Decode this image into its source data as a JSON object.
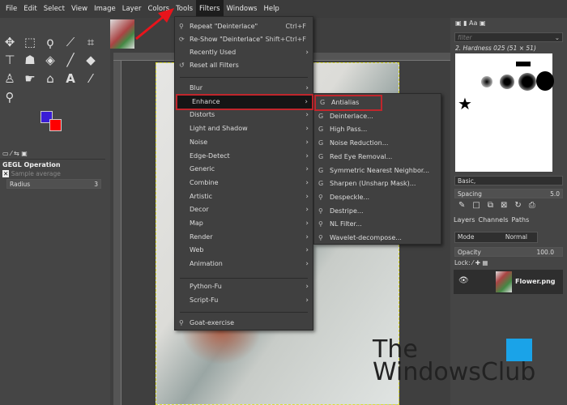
{
  "menubar": [
    "File",
    "Edit",
    "Select",
    "View",
    "Image",
    "Layer",
    "Colors",
    "Tools",
    "Filters",
    "Windows",
    "Help"
  ],
  "tool_options": {
    "title": "GEGL Operation",
    "sample_average": "Sample average",
    "radius_label": "Radius",
    "radius_value": "3"
  },
  "colors": {
    "foreground": "#3a1ed6",
    "background": "#ff0000",
    "highlight": "#c0262c"
  },
  "filters_menu": {
    "top": [
      {
        "label": "Repeat \"Deinterlace\"",
        "shortcut": "Ctrl+F"
      },
      {
        "label": "Re-Show \"Deinterlace\"",
        "shortcut": "Shift+Ctrl+F"
      },
      {
        "label": "Recently Used"
      },
      {
        "label": "Reset all Filters"
      }
    ],
    "categories": [
      "Blur",
      "Enhance",
      "Distorts",
      "Light and Shadow",
      "Noise",
      "Edge-Detect",
      "Generic",
      "Combine",
      "Artistic",
      "Decor",
      "Map",
      "Render",
      "Web",
      "Animation"
    ],
    "scripts": [
      "Python-Fu",
      "Script-Fu"
    ],
    "extra": "Goat-exercise"
  },
  "enhance_menu": [
    "Antialias",
    "Deinterlace...",
    "High Pass...",
    "Noise Reduction...",
    "Red Eye Removal...",
    "Symmetric Nearest Neighbor...",
    "Sharpen (Unsharp Mask)...",
    "Despeckle...",
    "Destripe...",
    "NL Filter...",
    "Wavelet-decompose..."
  ],
  "brushes": {
    "filter_placeholder": "filter",
    "selected": "2. Hardness 025 (51 × 51)",
    "tag": "Basic,",
    "spacing_label": "Spacing",
    "spacing_value": "5.0"
  },
  "layers": {
    "tabs": [
      "Layers",
      "Channels",
      "Paths"
    ],
    "mode_label": "Mode",
    "mode_value": "Normal",
    "opacity_label": "Opacity",
    "opacity_value": "100.0",
    "lock_label": "Lock:",
    "layer_name": "Flower.png"
  },
  "watermark": [
    "The",
    "WindowsClub"
  ]
}
